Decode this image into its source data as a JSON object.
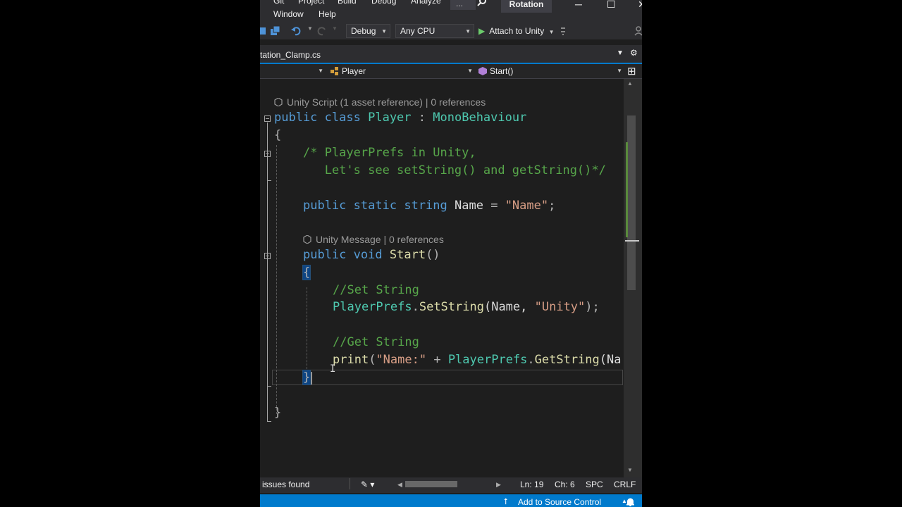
{
  "menubar": {
    "row1": [
      "Git",
      "Project",
      "Build",
      "Debug",
      "Analyze"
    ],
    "row2": [
      "Window",
      "Help"
    ],
    "overflow": "...",
    "title": "Rotation",
    "minimize": "─",
    "maximize": "☐",
    "close": "✕"
  },
  "toolbar": {
    "config": "Debug",
    "platform": "Any CPU",
    "attach_label": "Attach to Unity"
  },
  "document": {
    "tab_label": "tation_Clamp.cs",
    "nav": {
      "class_combo": "Player",
      "member_combo": "Start()"
    }
  },
  "code": {
    "lens_class": "Unity Script (1 asset reference) | 0 references",
    "lens_method": "Unity Message | 0 references",
    "lines": {
      "class_decl": {
        "kw1": "public",
        "kw2": "class",
        "name": "Player",
        "colon": ":",
        "base": "MonoBehaviour"
      },
      "open_brace": "{",
      "comment1": "/* PlayerPrefs in Unity,",
      "comment2": "   Let's see setString() and getString()*/",
      "field": {
        "kw1": "public",
        "kw2": "static",
        "kw3": "string",
        "name": "Name",
        "eq": " = ",
        "value": "\"Name\"",
        "semi": ";"
      },
      "method_decl": {
        "kw1": "public",
        "kw2": "void",
        "name": "Start",
        "parens": "()"
      },
      "method_open": "{",
      "set_comment": "//Set String",
      "set_call": {
        "cls": "PlayerPrefs",
        "dot": ".",
        "meth": "SetString",
        "open": "(Name, ",
        "arg": "\"Unity\"",
        "close": ");"
      },
      "get_comment": "//Get String",
      "get_call": {
        "fn": "print",
        "open": "(",
        "arg": "\"Name:\"",
        "plus": " + ",
        "cls": "PlayerPrefs",
        "dot": ".",
        "meth": "GetString",
        "rest": "(Na"
      },
      "method_close": "}",
      "class_close": "}"
    }
  },
  "infobar": {
    "issues": "issues found",
    "line": "Ln: 19",
    "col": "Ch: 6",
    "encoding": "SPC",
    "eol": "CRLF"
  },
  "statusbar": {
    "source_control": "Add to Source Control"
  }
}
